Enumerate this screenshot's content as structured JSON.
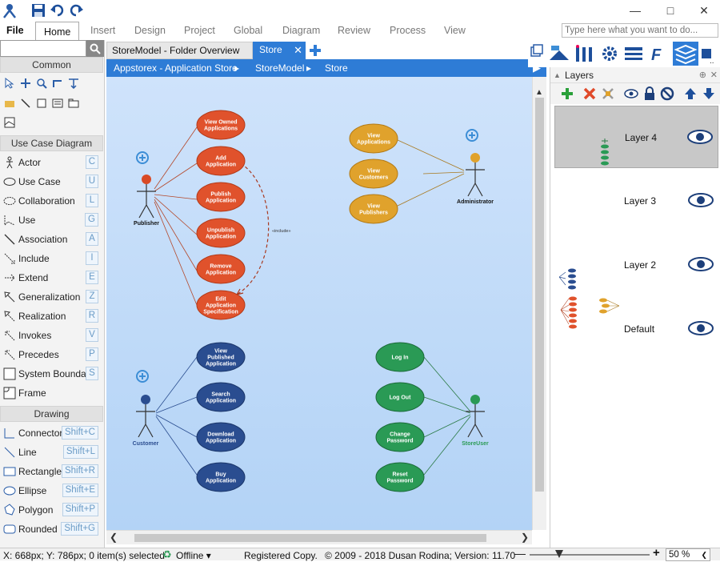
{
  "menu": {
    "file": "File",
    "home": "Home",
    "insert": "Insert",
    "design": "Design",
    "project": "Project",
    "global": "Global",
    "diagram": "Diagram",
    "review": "Review",
    "process": "Process",
    "view": "View"
  },
  "search": {
    "placeholder": "Type here what you want to do..."
  },
  "left_panel": {
    "sections": {
      "common": "Common",
      "use_case": "Use Case Diagram",
      "drawing": "Drawing"
    },
    "use_case_tools": [
      {
        "label": "Actor",
        "key": "C"
      },
      {
        "label": "Use Case",
        "key": "U"
      },
      {
        "label": "Collaboration",
        "key": "L"
      },
      {
        "label": "Use",
        "key": "G"
      },
      {
        "label": "Association",
        "key": "A"
      },
      {
        "label": "Include",
        "key": "I"
      },
      {
        "label": "Extend",
        "key": "E"
      },
      {
        "label": "Generalization",
        "key": "Z"
      },
      {
        "label": "Realization",
        "key": "R"
      },
      {
        "label": "Invokes",
        "key": "V"
      },
      {
        "label": "Precedes",
        "key": "P"
      },
      {
        "label": "System Boundary",
        "key": "S"
      },
      {
        "label": "Frame",
        "key": ""
      }
    ],
    "drawing_tools": [
      {
        "label": "Connector",
        "key": "Shift+C"
      },
      {
        "label": "Line",
        "key": "Shift+L"
      },
      {
        "label": "Rectangle",
        "key": "Shift+R"
      },
      {
        "label": "Ellipse",
        "key": "Shift+E"
      },
      {
        "label": "Polygon",
        "key": "Shift+P"
      },
      {
        "label": "Rounded",
        "key": "Shift+G"
      }
    ]
  },
  "tabs": [
    {
      "label": "StoreModel - Folder Overview"
    },
    {
      "label": "Store"
    }
  ],
  "breadcrumb": [
    "Appstorex - Application Store",
    "StoreModel",
    "Store"
  ],
  "diagram": {
    "actors": {
      "publisher": "Publisher",
      "administrator": "Administrator",
      "customer": "Customer",
      "store_user": "StoreUser"
    },
    "publisher_cases": [
      [
        "View Owned",
        "Applications"
      ],
      [
        "Add",
        "Application"
      ],
      [
        "Publish",
        "Application"
      ],
      [
        "Unpublish",
        "Application"
      ],
      [
        "Remove",
        "Application"
      ],
      [
        "Edit",
        "Application",
        "Specification"
      ]
    ],
    "admin_cases": [
      [
        "View",
        "Applications"
      ],
      [
        "View",
        "Customers"
      ],
      [
        "View",
        "Publishers"
      ]
    ],
    "customer_cases": [
      [
        "View",
        "Published",
        "Application"
      ],
      [
        "Search",
        "Application"
      ],
      [
        "Download",
        "Application"
      ],
      [
        "Buy",
        "Application"
      ]
    ],
    "user_cases": [
      [
        "Log In"
      ],
      [
        "Log Out"
      ],
      [
        "Change",
        "Password"
      ],
      [
        "Reset",
        "Password"
      ]
    ],
    "include_label": "«include»",
    "colors": {
      "publisher": "#e0522c",
      "admin": "#e0a22c",
      "customer": "#2a4d90",
      "user": "#2a9a55"
    }
  },
  "layers_panel": {
    "title": "Layers",
    "layers": [
      {
        "name": "Layer 4"
      },
      {
        "name": "Layer 3"
      },
      {
        "name": "Layer 2"
      },
      {
        "name": "Default"
      }
    ]
  },
  "status": {
    "coords": "X: 668px; Y: 786px; 0 item(s) selected",
    "mode": "Offline",
    "license": "Registered Copy.",
    "copyright": "© 2009 - 2018 Dusan Rodina; Version: 11.70",
    "zoom": "50 %"
  }
}
